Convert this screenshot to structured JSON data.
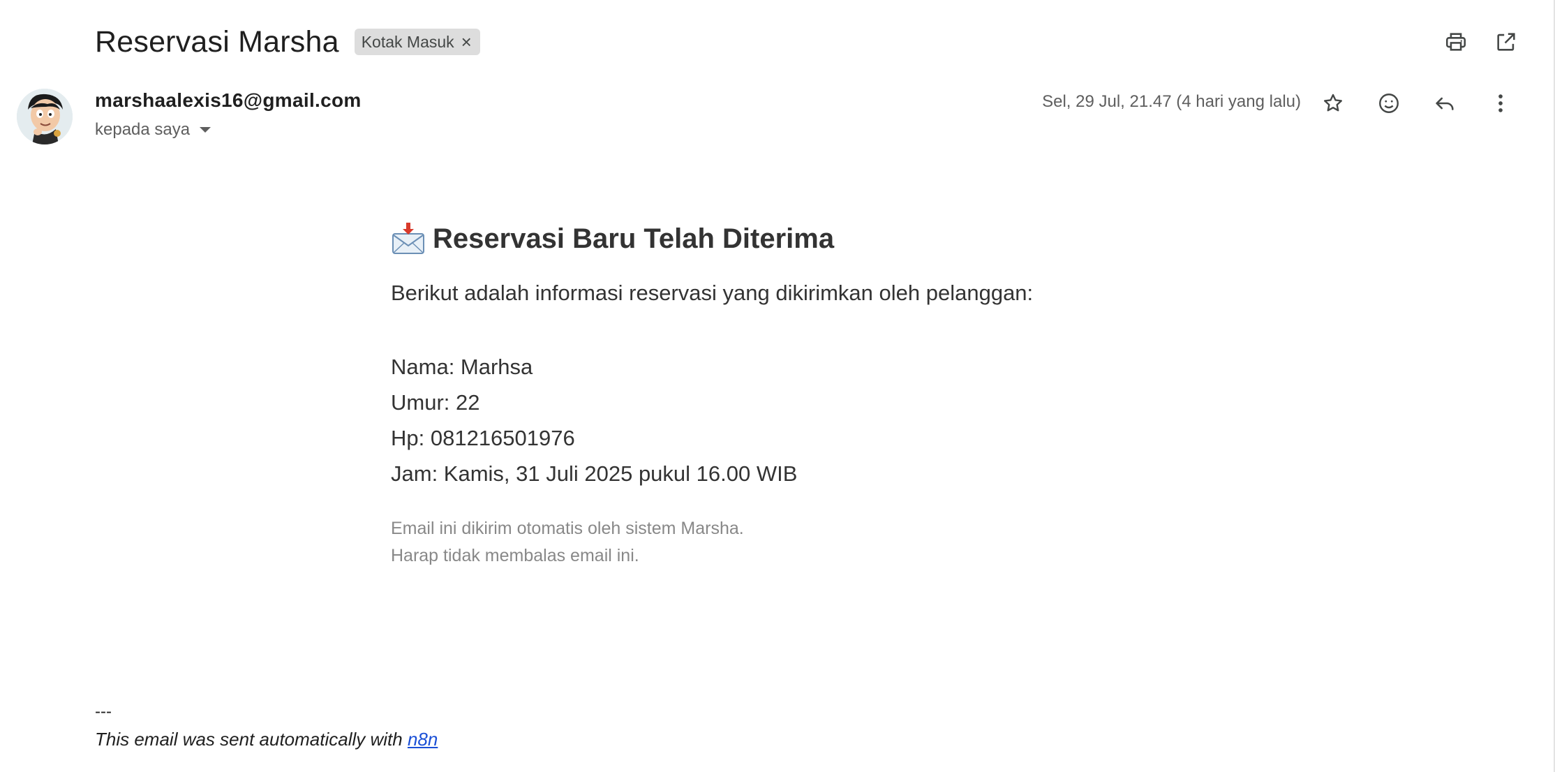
{
  "subject": {
    "title": "Reservasi Marsha",
    "label": "Kotak Masuk",
    "label_remove": "×"
  },
  "top_actions": [
    {
      "name": "print-icon"
    },
    {
      "name": "open-in-new-window-icon"
    }
  ],
  "sender": {
    "email": "marshaalexis16@gmail.com",
    "recipient": "kepada saya",
    "date": "Sel, 29 Jul, 21.47 (4 hari yang lalu)"
  },
  "message_actions": [
    {
      "name": "star-icon"
    },
    {
      "name": "emoji-reaction-icon"
    },
    {
      "name": "reply-icon"
    },
    {
      "name": "more-vert-icon"
    }
  ],
  "body": {
    "heading_icon": "incoming-envelope-icon",
    "heading": "Reservasi Baru Telah Diterima",
    "intro": "Berikut adalah informasi reservasi yang dikirimkan oleh pelanggan:",
    "details": [
      "Nama: Marhsa",
      "Umur: 22",
      "Hp: 081216501976",
      "Jam: Kamis, 31 Juli 2025 pukul 16.00 WIB"
    ],
    "footer_lines": [
      "Email ini dikirim otomatis oleh sistem Marsha.",
      "Harap tidak membalas email ini."
    ]
  },
  "signature": {
    "dash": "---",
    "text": "This email was sent automatically with ",
    "link": "n8n"
  },
  "colors": {
    "link": "#1a4fd6",
    "chip_bg": "#dddddd",
    "muted_text": "#888888"
  }
}
